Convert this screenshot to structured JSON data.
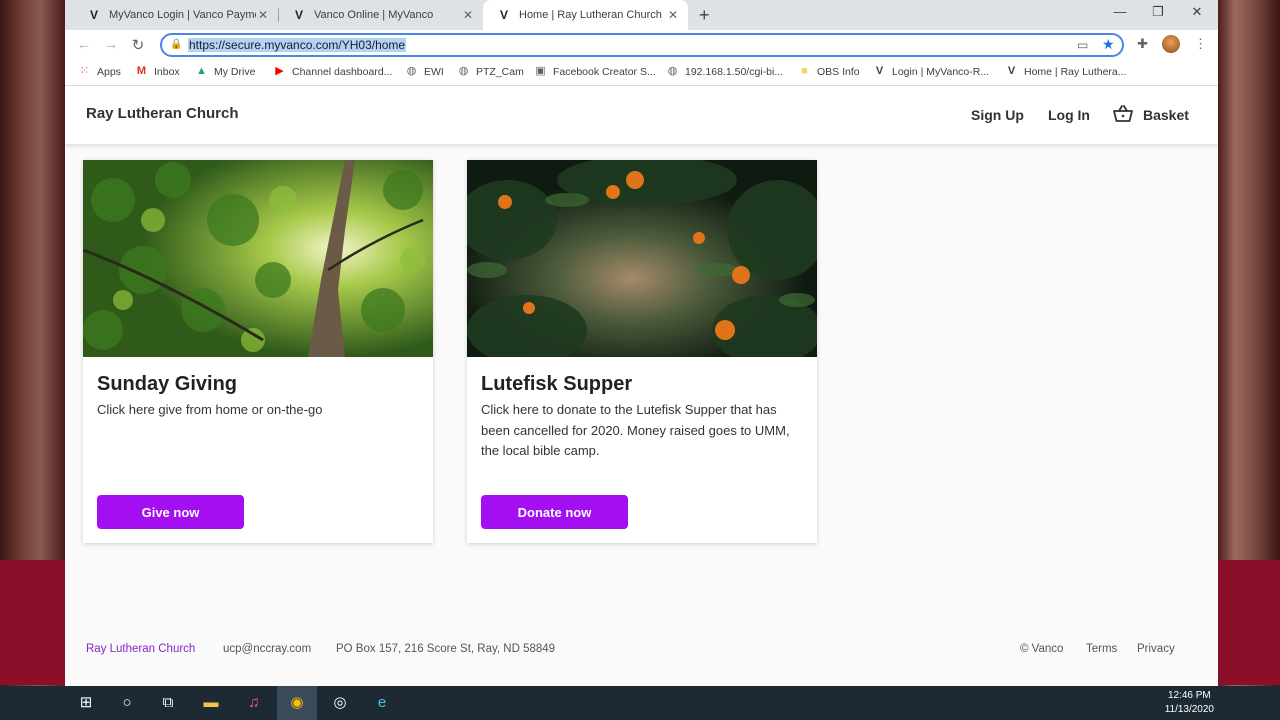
{
  "browser": {
    "tabs": [
      {
        "title": "MyVanco Login | Vanco Payment",
        "favicon": "V"
      },
      {
        "title": "Vanco Online | MyVanco",
        "favicon": "V"
      },
      {
        "title": "Home | Ray Lutheran Church",
        "favicon": "V"
      }
    ],
    "url": "https://secure.myvanco.com/YH03/home",
    "bookmarks": [
      {
        "label": "Apps",
        "icon": "apps-grid-icon"
      },
      {
        "label": "Inbox",
        "icon": "gmail-icon"
      },
      {
        "label": "My Drive",
        "icon": "drive-icon"
      },
      {
        "label": "Channel dashboard...",
        "icon": "youtube-icon"
      },
      {
        "label": "EWI",
        "icon": "globe-icon"
      },
      {
        "label": "PTZ_Cam",
        "icon": "globe-icon"
      },
      {
        "label": "Facebook Creator S...",
        "icon": "page-icon"
      },
      {
        "label": "192.168.1.50/cgi-bi...",
        "icon": "globe-icon"
      },
      {
        "label": "OBS Info",
        "icon": "folder-icon"
      },
      {
        "label": "Login | MyVanco-R...",
        "icon": "vanco-icon"
      },
      {
        "label": "Home | Ray Luthera...",
        "icon": "vanco-icon"
      }
    ]
  },
  "site": {
    "title": "Ray Lutheran Church",
    "nav": {
      "signup": "Sign Up",
      "login": "Log In",
      "basket": "Basket"
    }
  },
  "cards": [
    {
      "title": "Sunday Giving",
      "description": "Click here give from home or on-the-go",
      "button": "Give now"
    },
    {
      "title": "Lutefisk Supper",
      "description": "Click here to donate to the Lutefisk Supper that has been cancelled for 2020. Money raised goes to UMM, the local bible camp.",
      "button": "Donate now"
    }
  ],
  "footer": {
    "brand": "Ray Lutheran Church",
    "email": "ucp@nccray.com",
    "address": "PO Box 157, 216 Score St, Ray, ND 58849",
    "copyright": "© Vanco",
    "terms": "Terms",
    "privacy": "Privacy"
  },
  "taskbar": {
    "time": "12:46 PM",
    "date": "11/13/2020"
  },
  "colors": {
    "accent": "#a30ff0",
    "brand_link": "#8b23c7"
  }
}
